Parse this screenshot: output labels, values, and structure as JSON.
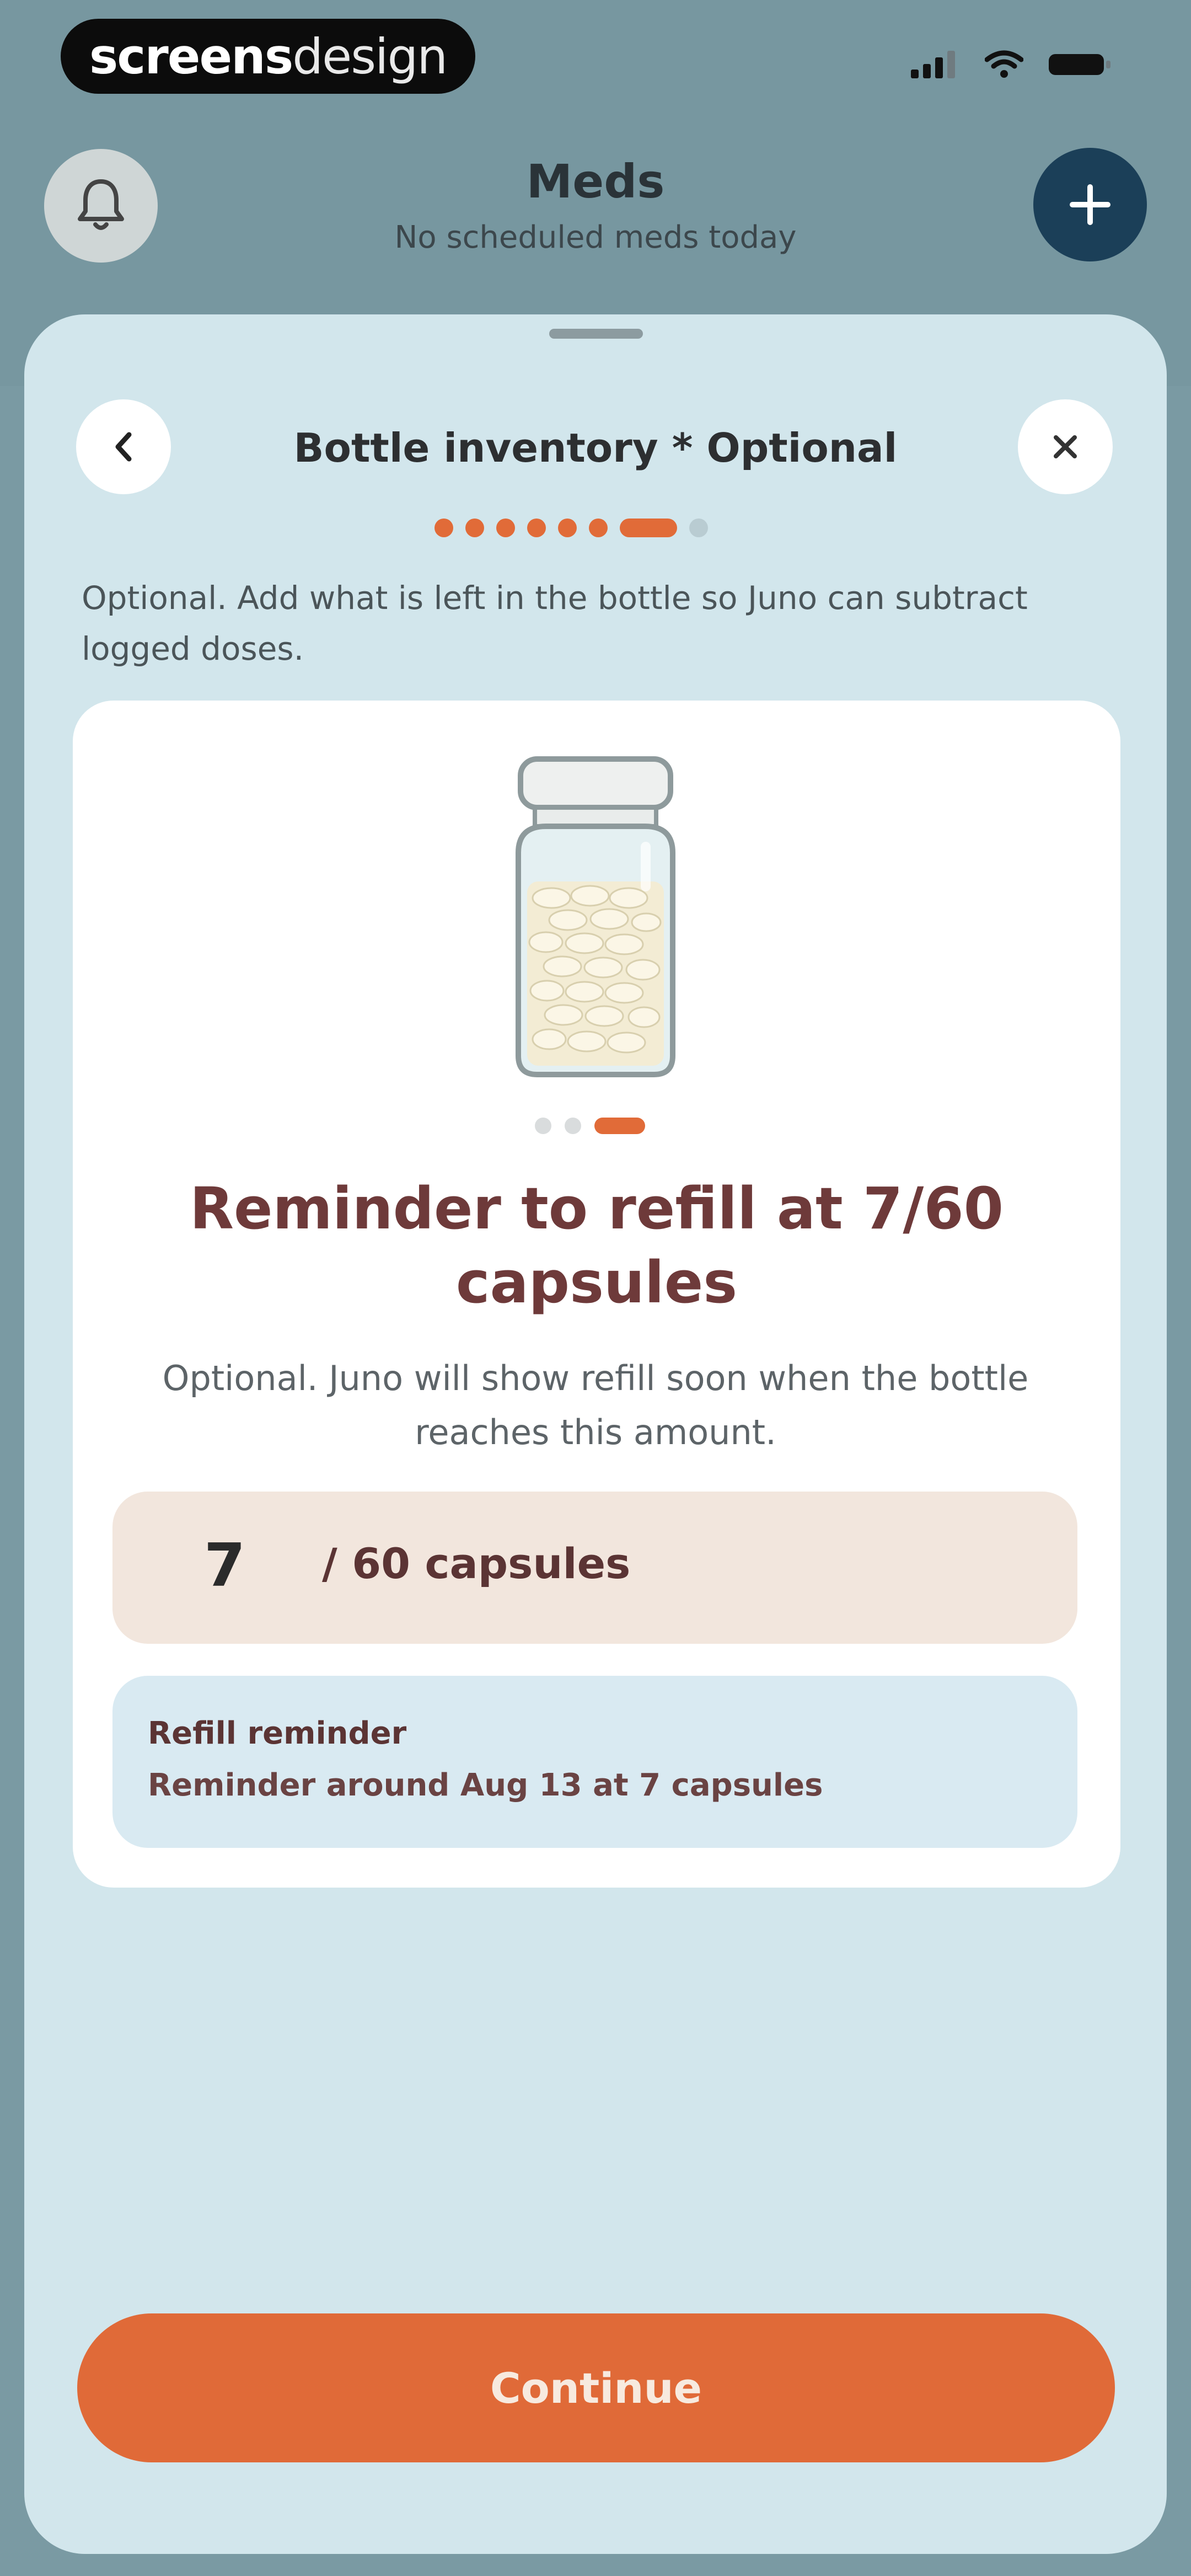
{
  "watermark": {
    "bold": "screens",
    "light": "design"
  },
  "header": {
    "title": "Meds",
    "subtitle": "No scheduled meds today"
  },
  "sheet": {
    "title": "Bottle inventory * Optional",
    "intro": "Optional. Add what is left in the bottle so Juno can subtract logged doses.",
    "steps_total": 8,
    "steps_current": 7
  },
  "card": {
    "headline": "Reminder to refill at 7/60 capsules",
    "subtext": "Optional. Juno will show refill soon when the bottle reaches this amount.",
    "carousel_total": 3,
    "carousel_current": 3,
    "amount_value": "7",
    "amount_unit": "/ 60 capsules",
    "reminder_title": "Refill reminder",
    "reminder_text": "Reminder around Aug 13 at 7 capsules"
  },
  "continue_label": "Continue",
  "icons": {
    "bell": "bell-icon",
    "add": "plus-icon",
    "back": "chevron-left-icon",
    "close": "close-icon",
    "bottle": "pill-bottle-illustration"
  },
  "colors": {
    "accent": "#e06a38",
    "headline": "#6e3a3a",
    "sheet": "#d2e6ec",
    "add_button": "#1b3f58"
  }
}
